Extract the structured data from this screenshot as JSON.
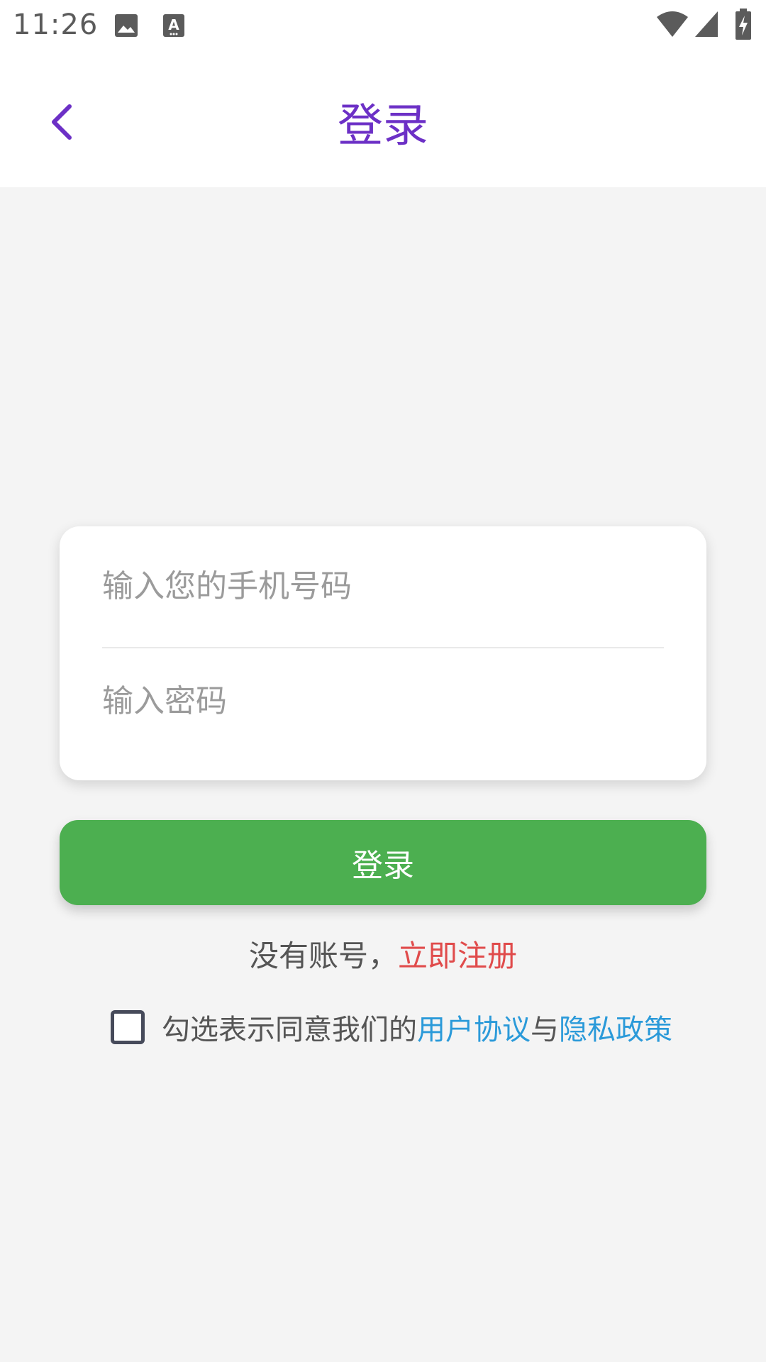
{
  "status_bar": {
    "time": "11:26",
    "icons": [
      "image-icon",
      "text-icon",
      "wifi-icon",
      "signal-icon",
      "battery-charging-icon"
    ]
  },
  "header": {
    "title": "登录",
    "back_icon": "chevron-left-icon"
  },
  "form": {
    "phone_placeholder": "输入您的手机号码",
    "password_placeholder": "输入密码"
  },
  "login_button": {
    "label": "登录",
    "color": "#4caf50"
  },
  "register": {
    "prompt": "没有账号，",
    "link": "立即注册",
    "link_color": "#e04b4b"
  },
  "agreement": {
    "checked": false,
    "prefix": "勾选表示同意我们的",
    "user_agreement": "用户协议",
    "conjunction": "与",
    "privacy_policy": "隐私政策",
    "link_color": "#2b9ad9"
  },
  "colors": {
    "accent": "#6c30c6",
    "background": "#f4f4f4"
  }
}
